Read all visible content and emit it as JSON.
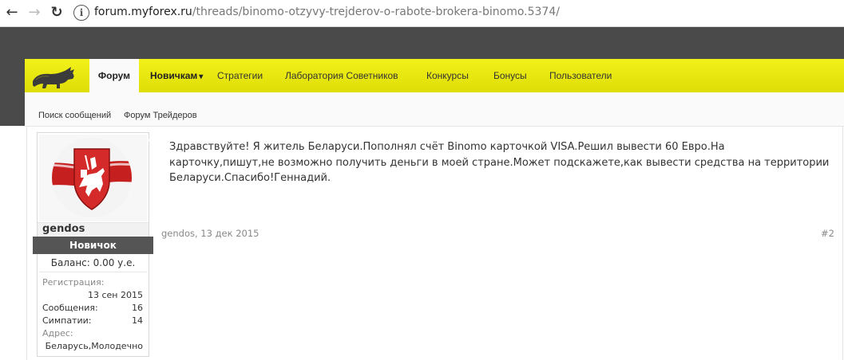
{
  "browser": {
    "url_host": "forum.myforex.ru",
    "url_path": "/threads/binomo-otzyvy-trejderov-o-rabote-brokera-binomo.5374/",
    "back_icon": "←",
    "forward_icon": "→",
    "reload_icon": "↻",
    "info_icon": "i"
  },
  "nav": {
    "tabs": [
      {
        "label": "Форум"
      },
      {
        "label": "Новичкам"
      },
      {
        "label": "Стратегии"
      },
      {
        "label": "Лаборатория Советников"
      },
      {
        "label": "Конкурсы"
      },
      {
        "label": "Бонусы"
      },
      {
        "label": "Пользователи"
      }
    ],
    "dropdown_glyph": "▾",
    "subtabs": [
      {
        "label": "Поиск сообщений"
      },
      {
        "label": "Форум Трейдеров"
      }
    ]
  },
  "post": {
    "user": {
      "name": "gendos",
      "rank": "Новичок",
      "balance": "Баланс: 0.00 у.е.",
      "registration_label": "Регистрация:",
      "registration_value": "13 сен 2015",
      "messages_label": "Сообщения:",
      "messages_value": "16",
      "likes_label": "Симпатии:",
      "likes_value": "14",
      "address_label": "Адрес:",
      "address_value": "Беларусь,Молодечно"
    },
    "message": "Здравствуйте! Я житель Беларуси.Пополнял счёт Binomo карточкой VISA.Решил вывести 60 Евро.На карточку,пишут,не возможно получить деньги в моей стране.Может подскажете,как вывести средства на территории Беларуси.Спасибо!Геннадий.",
    "author_date": "gendos, 13 дек 2015",
    "post_number": "#2"
  },
  "colors": {
    "navbar_yellow": "#eeee14",
    "dark_band": "#4a4a4a",
    "rank_bg": "#555555",
    "coat_red": "#d42a2a"
  }
}
